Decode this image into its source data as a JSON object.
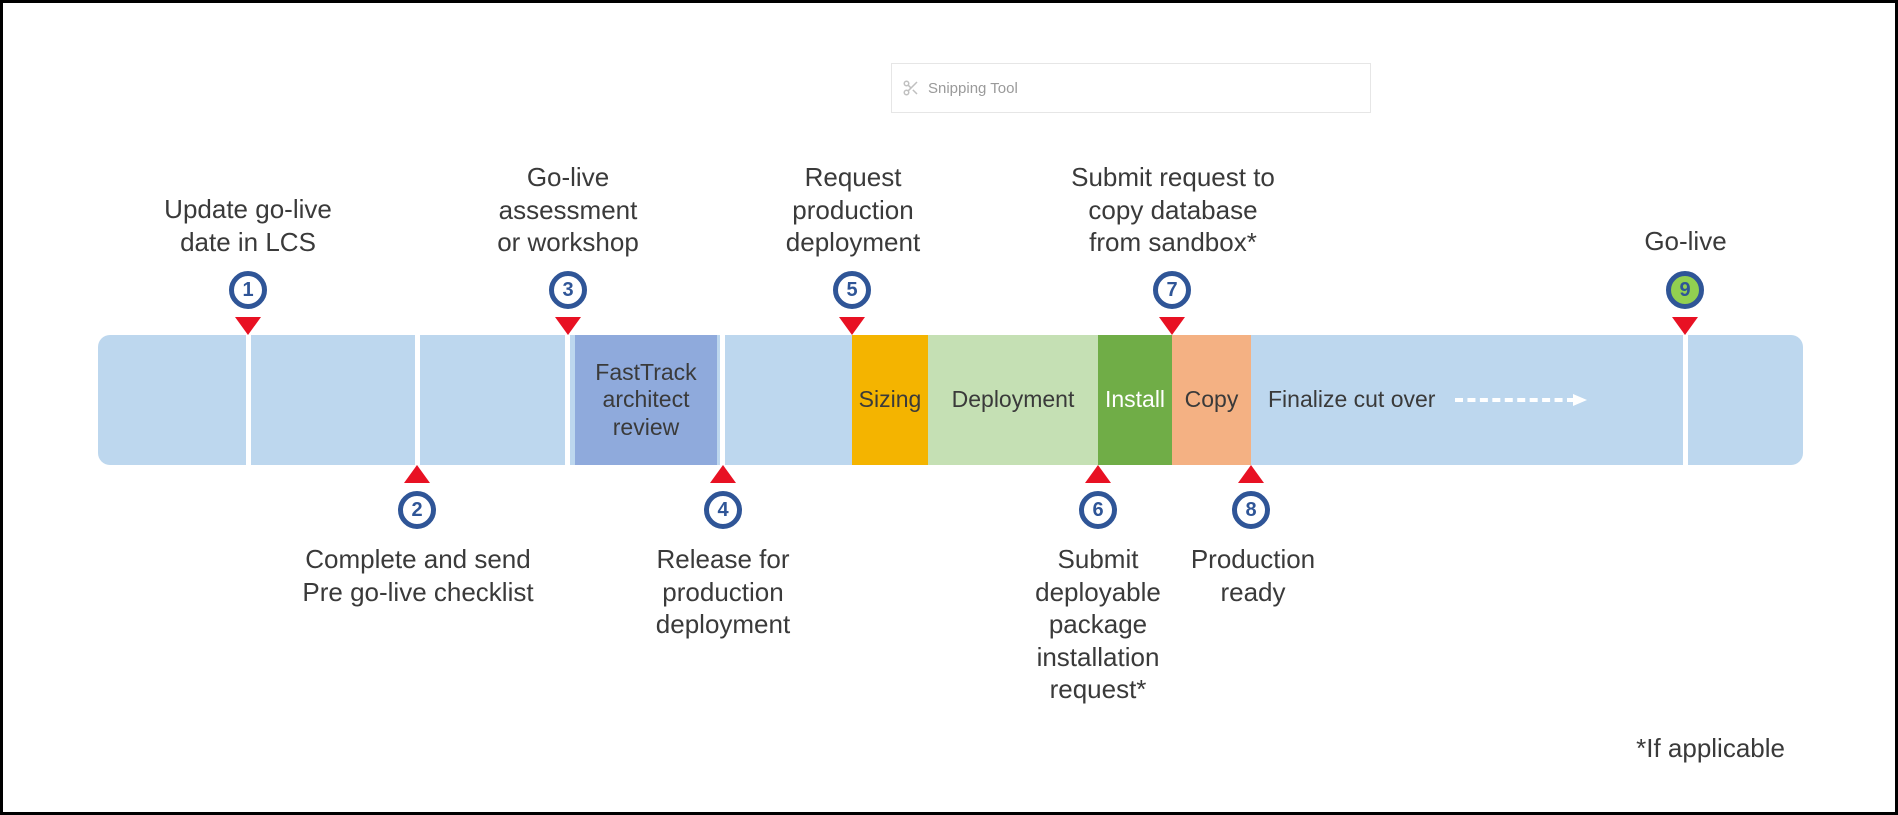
{
  "watermark": {
    "label": "Snipping Tool"
  },
  "segments": {
    "fasttrack": "FastTrack\narchitect\nreview",
    "sizing": "Sizing",
    "deployment": "Deployment",
    "install": "Install",
    "copy": "Copy",
    "finalize": "Finalize cut over"
  },
  "steps": {
    "1": {
      "num": "1",
      "text": "Update go-live\ndate in LCS"
    },
    "2": {
      "num": "2",
      "text": "Complete and send\nPre go-live checklist"
    },
    "3": {
      "num": "3",
      "text": "Go-live\nassessment\nor workshop"
    },
    "4": {
      "num": "4",
      "text": "Release for\nproduction\ndeployment"
    },
    "5": {
      "num": "5",
      "text": "Request\nproduction\ndeployment"
    },
    "6": {
      "num": "6",
      "text": "Submit\ndeployable\npackage\ninstallation\nrequest*"
    },
    "7": {
      "num": "7",
      "text": "Submit request to\ncopy database\nfrom sandbox*"
    },
    "8": {
      "num": "8",
      "text": "Production\nready"
    },
    "9": {
      "num": "9",
      "text": "Go-live"
    }
  },
  "footnote": "*If applicable"
}
